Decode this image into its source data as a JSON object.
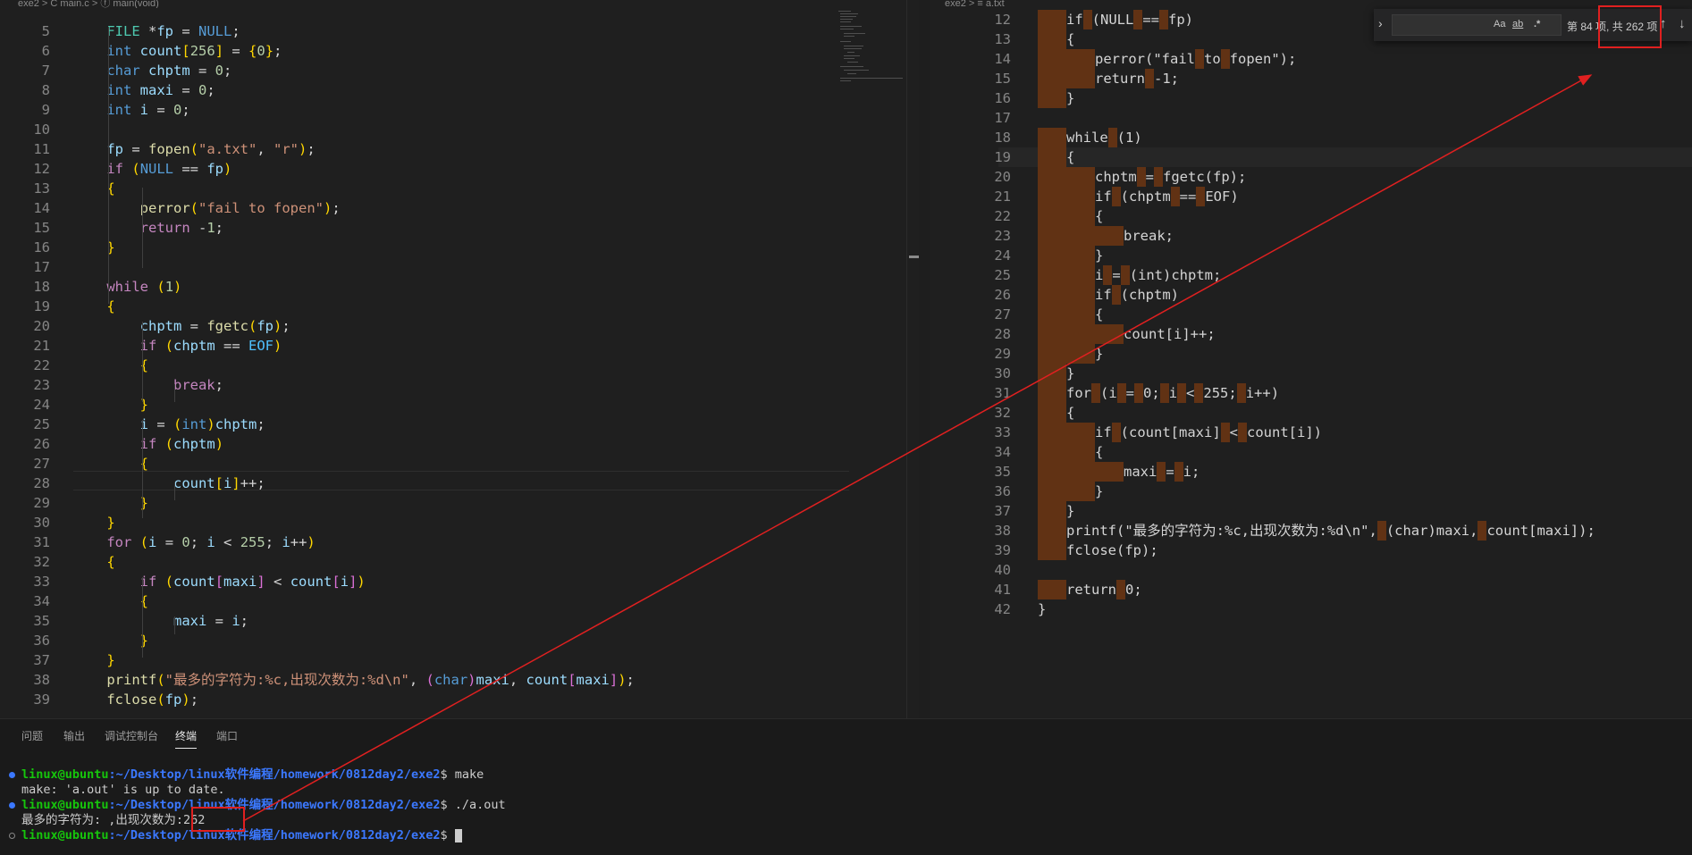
{
  "left_editor": {
    "breadcrumb": "exe2 > C main.c > ⓕ main(void)",
    "lines": [
      {
        "num": "5",
        "code": "    FILE *fp = NULL;"
      },
      {
        "num": "6",
        "code": "    int count[256] = {0};"
      },
      {
        "num": "7",
        "code": "    char chptm = 0;"
      },
      {
        "num": "8",
        "code": "    int maxi = 0;"
      },
      {
        "num": "9",
        "code": "    int i = 0;"
      },
      {
        "num": "10",
        "code": ""
      },
      {
        "num": "11",
        "code": "    fp = fopen(\"a.txt\", \"r\");"
      },
      {
        "num": "12",
        "code": "    if (NULL == fp)"
      },
      {
        "num": "13",
        "code": "    {"
      },
      {
        "num": "14",
        "code": "        perror(\"fail to fopen\");"
      },
      {
        "num": "15",
        "code": "        return -1;"
      },
      {
        "num": "16",
        "code": "    }"
      },
      {
        "num": "17",
        "code": ""
      },
      {
        "num": "18",
        "code": "    while (1)"
      },
      {
        "num": "19",
        "code": "    {"
      },
      {
        "num": "20",
        "code": "        chptm = fgetc(fp);"
      },
      {
        "num": "21",
        "code": "        if (chptm == EOF)"
      },
      {
        "num": "22",
        "code": "        {"
      },
      {
        "num": "23",
        "code": "            break;"
      },
      {
        "num": "24",
        "code": "        }"
      },
      {
        "num": "25",
        "code": "        i = (int)chptm;"
      },
      {
        "num": "26",
        "code": "        if (chptm)"
      },
      {
        "num": "27",
        "code": "        {"
      },
      {
        "num": "28",
        "code": "            count[i]++;"
      },
      {
        "num": "29",
        "code": "        }"
      },
      {
        "num": "30",
        "code": "    }"
      },
      {
        "num": "31",
        "code": "    for (i = 0; i < 255; i++)"
      },
      {
        "num": "32",
        "code": "    {"
      },
      {
        "num": "33",
        "code": "        if (count[maxi] < count[i])"
      },
      {
        "num": "34",
        "code": "        {"
      },
      {
        "num": "35",
        "code": "            maxi = i;"
      },
      {
        "num": "36",
        "code": "        }"
      },
      {
        "num": "37",
        "code": "    }"
      },
      {
        "num": "38",
        "code": "    printf(\"最多的字符为:%c,出现次数为:%d\\n\", (char)maxi, count[maxi]);"
      },
      {
        "num": "39",
        "code": "    fclose(fp);"
      }
    ]
  },
  "right_editor": {
    "breadcrumb": "exe2 > ≡ a.txt",
    "lines": [
      {
        "num": "12",
        "code": "    if (NULL == fp)"
      },
      {
        "num": "13",
        "code": "    {"
      },
      {
        "num": "14",
        "code": "        perror(\"fail to fopen\");"
      },
      {
        "num": "15",
        "code": "        return -1;"
      },
      {
        "num": "16",
        "code": "    }"
      },
      {
        "num": "17",
        "code": ""
      },
      {
        "num": "18",
        "code": "    while (1)"
      },
      {
        "num": "19",
        "code": "    {"
      },
      {
        "num": "20",
        "code": "        chptm = fgetc(fp);"
      },
      {
        "num": "21",
        "code": "        if (chptm == EOF)"
      },
      {
        "num": "22",
        "code": "        {"
      },
      {
        "num": "23",
        "code": "            break;"
      },
      {
        "num": "24",
        "code": "        }"
      },
      {
        "num": "25",
        "code": "        i = (int)chptm;"
      },
      {
        "num": "26",
        "code": "        if (chptm)"
      },
      {
        "num": "27",
        "code": "        {"
      },
      {
        "num": "28",
        "code": "            count[i]++;"
      },
      {
        "num": "29",
        "code": "        }"
      },
      {
        "num": "30",
        "code": "    }"
      },
      {
        "num": "31",
        "code": "    for (i = 0; i < 255; i++)"
      },
      {
        "num": "32",
        "code": "    {"
      },
      {
        "num": "33",
        "code": "        if (count[maxi] < count[i])"
      },
      {
        "num": "34",
        "code": "        {"
      },
      {
        "num": "35",
        "code": "            maxi = i;"
      },
      {
        "num": "36",
        "code": "        }"
      },
      {
        "num": "37",
        "code": "    }"
      },
      {
        "num": "38",
        "code": "    printf(\"最多的字符为:%c,出现次数为:%d\\n\", (char)maxi, count[maxi]);"
      },
      {
        "num": "39",
        "code": "    fclose(fp);"
      },
      {
        "num": "40",
        "code": ""
      },
      {
        "num": "41",
        "code": "    return 0;"
      },
      {
        "num": "42",
        "code": "}"
      }
    ]
  },
  "find_widget": {
    "toggle_icon": "chevron-right-icon",
    "match_case": "Aa",
    "whole_word": "ab",
    "regex": ".*",
    "result_prefix": "第 84 项,",
    "result_total": "共 262 项",
    "prev_icon": "arrow-up-icon",
    "next_icon": "arrow-down-icon"
  },
  "panel": {
    "tabs": [
      "问题",
      "输出",
      "调试控制台",
      "终端",
      "端口"
    ],
    "active_tab": "终端",
    "terminal": [
      {
        "user": "linux@ubuntu",
        "path": ":~/Desktop/linux软件编程/homework/0812day2/exe2",
        "cmd": "$ make"
      },
      {
        "output": "make: 'a.out' is up to date."
      },
      {
        "user": "linux@ubuntu",
        "path": ":~/Desktop/linux软件编程/homework/0812day2/exe2",
        "cmd": "$ ./a.out"
      },
      {
        "output": "最多的字符为: ,出现次数为:262"
      },
      {
        "user": "linux@ubuntu",
        "path": ":~/Desktop/linux软件编程/homework/0812day2/exe2",
        "cmd": "$ "
      }
    ]
  },
  "colors": {
    "annotation": "#e02020",
    "find_highlight": "#613214",
    "accent": "#3b78ff"
  }
}
